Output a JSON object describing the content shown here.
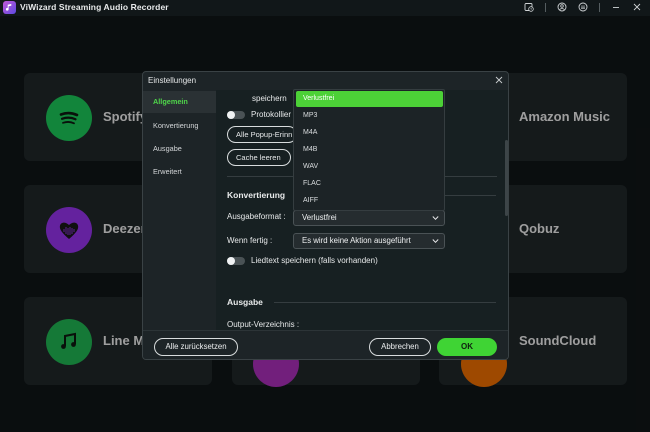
{
  "app": {
    "title": "ViWizard Streaming Audio Recorder"
  },
  "titlebar_icons": [
    "history-icon",
    "account-icon",
    "menu-icon",
    "minimize-icon",
    "close-icon"
  ],
  "cards": [
    {
      "name": "Spotify",
      "icon": "spotify-icon",
      "color": "#1ed760"
    },
    {
      "name": "Amazon Music",
      "icon": "amazon-music-icon",
      "color": "#232a2d"
    },
    {
      "name": "Deezer",
      "icon": "deezer-icon",
      "color": "#a238ff"
    },
    {
      "name": "Qobuz",
      "icon": "qobuz-icon",
      "color": "#232a2d"
    },
    {
      "name": "Line Music",
      "icon": "line-music-icon",
      "color": "#22c45a"
    },
    {
      "name": "SoundCloud",
      "icon": "soundcloud-icon",
      "color": "#ff7700"
    }
  ],
  "dialog": {
    "title": "Einstellungen",
    "sidebar": [
      {
        "label": "Allgemein",
        "active": true
      },
      {
        "label": "Konvertierung",
        "active": false
      },
      {
        "label": "Ausgabe",
        "active": false
      },
      {
        "label": "Erweitert",
        "active": false
      }
    ],
    "general": {
      "save_label": "speichern",
      "log_toggle_label": "Protokollier",
      "popup_button": "Alle Popup-Erinn",
      "clear_cache_button": "Cache leeren"
    },
    "conversion": {
      "section_title": "Konvertierung",
      "format_label": "Ausgabeformat :",
      "format_value": "Verlustfrei",
      "finish_label": "Wenn fertig :",
      "finish_value": "Es wird keine Aktion ausgeführt",
      "lyrics_toggle_label": "Liedtext speichern (falls vorhanden)"
    },
    "output": {
      "section_title": "Ausgabe",
      "dir_label": "Output-Verzeichnis :"
    },
    "format_dropdown": [
      "Verlustfrei",
      "MP3",
      "M4A",
      "M4B",
      "WAV",
      "FLAC",
      "AIFF"
    ],
    "footer": {
      "reset_button": "Alle zurücksetzen",
      "cancel_button": "Abbrechen",
      "ok_button": "OK"
    }
  },
  "colors": {
    "accent": "#3fd434",
    "dropdown_selected": "#4cd137"
  }
}
